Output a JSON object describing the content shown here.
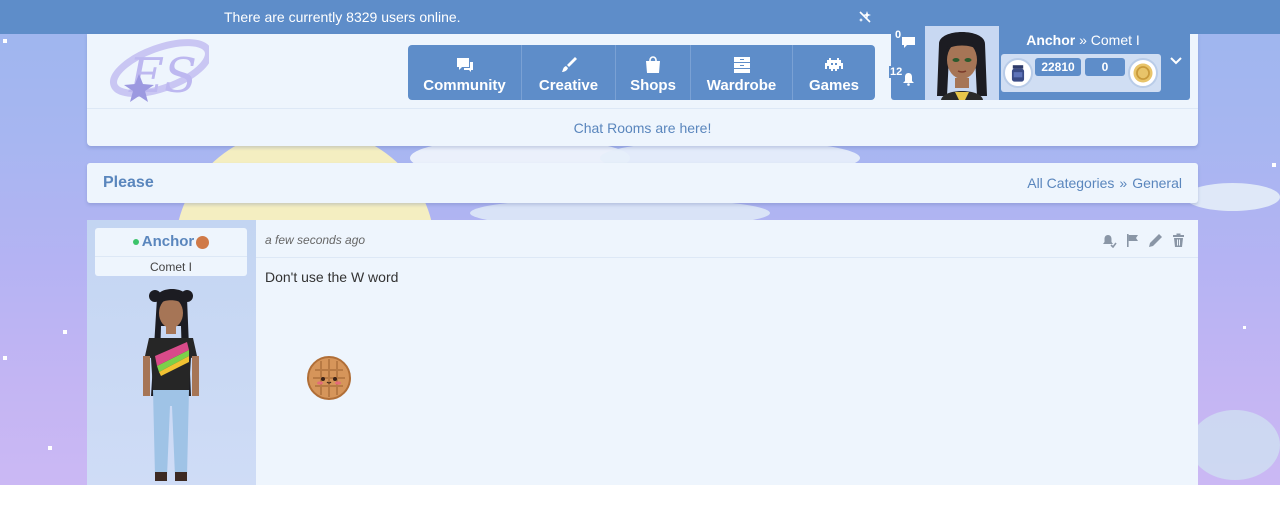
{
  "topbar": {
    "online_text": "There are currently 8329 users online.",
    "sparkle_icon": "sparkle-slash-icon"
  },
  "nav": [
    {
      "label": "Community",
      "icon": "chat-bubbles-icon"
    },
    {
      "label": "Creative",
      "icon": "paintbrush-icon"
    },
    {
      "label": "Shops",
      "icon": "shopping-bag-icon"
    },
    {
      "label": "Wardrobe",
      "icon": "dresser-icon"
    },
    {
      "label": "Games",
      "icon": "space-invader-icon"
    }
  ],
  "announcement": "Chat Rooms are here!",
  "user": {
    "name": "Anchor",
    "separator": "»",
    "rank": "Comet I",
    "messages_count": "0",
    "notifications_count": "12",
    "currency_1": "22810",
    "currency_2": "0"
  },
  "thread": {
    "title": "Please",
    "breadcrumb_1": "All Categories",
    "breadcrumb_sep": "»",
    "breadcrumb_2": "General"
  },
  "post": {
    "author": "Anchor",
    "rank": "Comet I",
    "time": "a few seconds ago",
    "text": "Don't use the W word"
  },
  "colors": {
    "brand_blue": "#5e8dc9",
    "panel": "#eef5fd",
    "link": "#5a86bd",
    "online": "#3cc46b"
  }
}
